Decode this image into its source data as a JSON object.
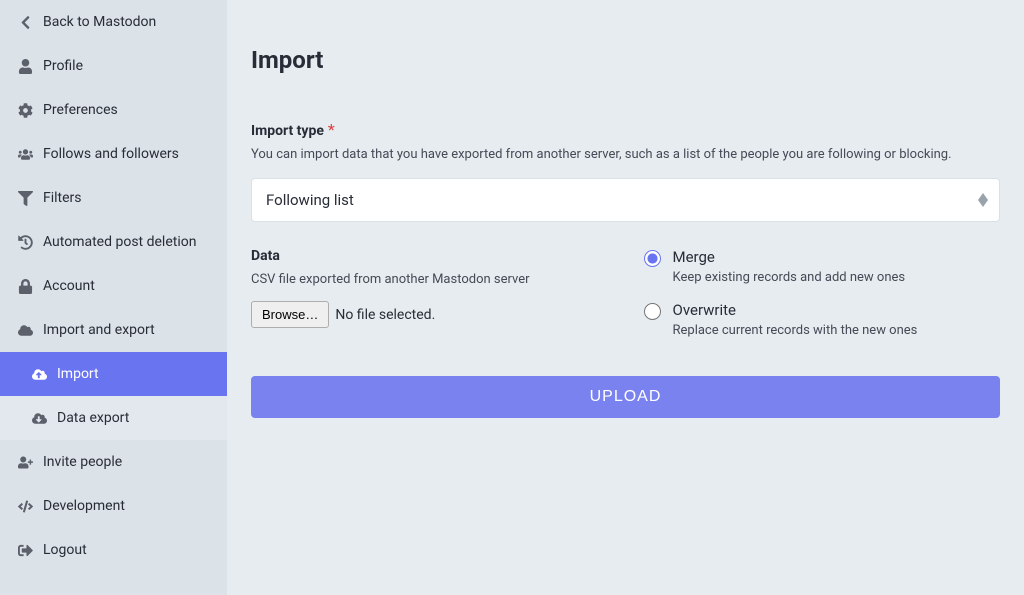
{
  "sidebar": {
    "items": [
      {
        "label": "Back to Mastodon"
      },
      {
        "label": "Profile"
      },
      {
        "label": "Preferences"
      },
      {
        "label": "Follows and followers"
      },
      {
        "label": "Filters"
      },
      {
        "label": "Automated post deletion"
      },
      {
        "label": "Account"
      },
      {
        "label": "Import and export"
      },
      {
        "label": "Import"
      },
      {
        "label": "Data export"
      },
      {
        "label": "Invite people"
      },
      {
        "label": "Development"
      },
      {
        "label": "Logout"
      }
    ]
  },
  "main": {
    "title": "Import",
    "import_type": {
      "label": "Import type",
      "required": "*",
      "hint": "You can import data that you have exported from another server, such as a list of the people you are following or blocking.",
      "value": "Following list"
    },
    "data": {
      "label": "Data",
      "hint": "CSV file exported from another Mastodon server",
      "browse_label": "Browse…",
      "file_status": "No file selected."
    },
    "mode": {
      "options": [
        {
          "label": "Merge",
          "hint": "Keep existing records and add new ones"
        },
        {
          "label": "Overwrite",
          "hint": "Replace current records with the new ones"
        }
      ]
    },
    "upload_label": "UPLOAD"
  }
}
